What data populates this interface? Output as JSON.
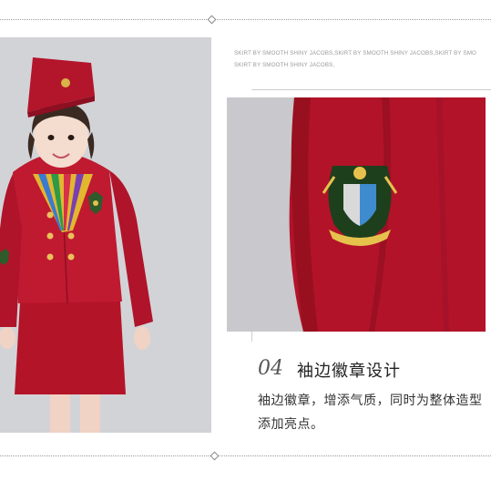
{
  "caption": {
    "text": "SKIRT BY SMOOTH SHINY JACOBS,SKIRT BY SMOOTH SHINY JACOBS,SKIRT BY SMO SKIRT BY SMOOTH SHINY JACOBS,"
  },
  "feature": {
    "number": "04",
    "title": "袖边徽章设计",
    "description": "袖边徽章，增添气质，同时为整体造型添加亮点。"
  },
  "colors": {
    "uniform_red": "#b8152b",
    "background_grey": "#d2d3d7"
  }
}
